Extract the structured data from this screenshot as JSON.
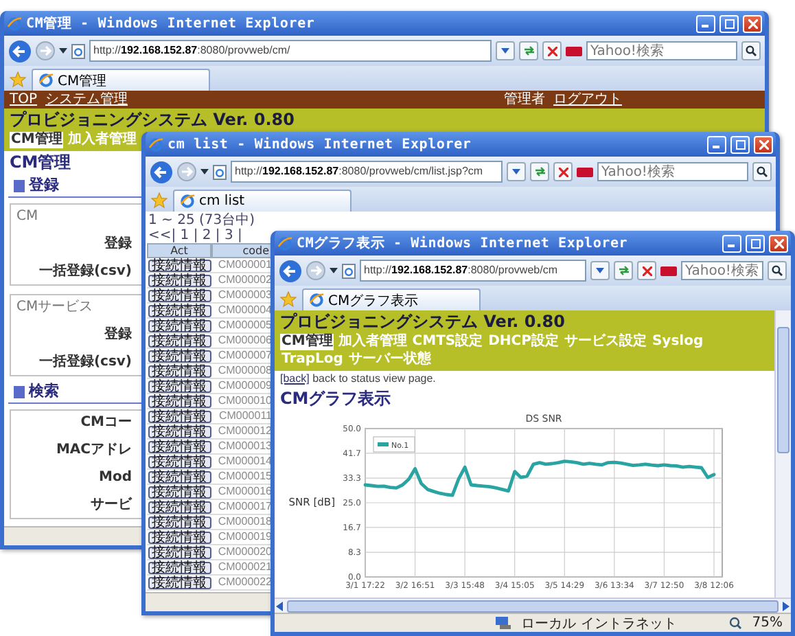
{
  "cm_window": {
    "title": "CM管理 - Windows Internet Explorer",
    "address": "http://**192.168.152.87**:8080/provweb/cm/",
    "search": {
      "placeholder": "Yahoo!検索"
    },
    "tab": "CM管理",
    "top_links": [
      "TOP",
      "システム管理"
    ],
    "user": {
      "label": "管理者",
      "link": "ログアウト"
    },
    "system_title": "プロビジョニングシステム Ver. 0.80",
    "menu": [
      {
        "label": "CM管理",
        "selected": true
      },
      {
        "label": "加入者管理",
        "selected": false
      }
    ],
    "heading": "CM管理",
    "sections": [
      {
        "title": "登録",
        "groups": [
          {
            "legend": "CM",
            "labels": [
              "登録",
              "一括登録(csv)"
            ]
          },
          {
            "legend": "CMサービス",
            "labels": [
              "登録",
              "一括登録(csv)"
            ]
          }
        ]
      },
      {
        "title": "検索",
        "groups": [
          {
            "labels": [
              "CMコー",
              "MACアドレ",
              "Mod",
              "サービ"
            ]
          }
        ]
      }
    ]
  },
  "list_window": {
    "title": "cm list - Windows Internet Explorer",
    "address": "http://**192.168.152.87**:8080/provweb/cm/list.jsp?cm",
    "search": {
      "placeholder": "Yahoo!検索"
    },
    "tab": "cm list",
    "pager": "1 ~ 25 (73台中) <<| 1 | 2 | 3 |",
    "columns": [
      "Act",
      "code"
    ],
    "rows": [
      {
        "action": "接続情報",
        "code": "CM000001"
      },
      {
        "action": "接続情報",
        "code": "CM000002"
      },
      {
        "action": "接続情報",
        "code": "CM000003"
      },
      {
        "action": "接続情報",
        "code": "CM000004"
      },
      {
        "action": "接続情報",
        "code": "CM000005"
      },
      {
        "action": "接続情報",
        "code": "CM000006"
      },
      {
        "action": "接続情報",
        "code": "CM000007"
      },
      {
        "action": "接続情報",
        "code": "CM000008"
      },
      {
        "action": "接続情報",
        "code": "CM000009"
      },
      {
        "action": "接続情報",
        "code": "CM000010"
      },
      {
        "action": "接続情報",
        "code": "CM000011"
      },
      {
        "action": "接続情報",
        "code": "CM000012"
      },
      {
        "action": "接続情報",
        "code": "CM000013"
      },
      {
        "action": "接続情報",
        "code": "CM000014"
      },
      {
        "action": "接続情報",
        "code": "CM000015"
      },
      {
        "action": "接続情報",
        "code": "CM000016"
      },
      {
        "action": "接続情報",
        "code": "CM000017"
      },
      {
        "action": "接続情報",
        "code": "CM000018"
      },
      {
        "action": "接続情報",
        "code": "CM000019"
      },
      {
        "action": "接続情報",
        "code": "CM000020"
      },
      {
        "action": "接続情報",
        "code": "CM000021"
      },
      {
        "action": "接続情報",
        "code": "CM000022"
      }
    ]
  },
  "graph_window": {
    "title": "CMグラフ表示 - Windows Internet Explorer",
    "address": "http://**192.168.152.87**:8080/provweb/cm",
    "search": {
      "placeholder": "Yahoo!検索"
    },
    "tab": "CMグラフ表示",
    "system_title": "プロビジョニングシステム Ver. 0.80",
    "menu": [
      {
        "label": "CM管理",
        "selected": true
      },
      {
        "label": "加入者管理",
        "selected": false
      },
      {
        "label": "CMTS設定",
        "selected": false
      },
      {
        "label": "DHCP設定",
        "selected": false
      },
      {
        "label": "サービス設定",
        "selected": false
      },
      {
        "label": "Syslog",
        "selected": false
      },
      {
        "label": "TrapLog",
        "selected": false
      },
      {
        "label": "サーバー状態",
        "selected": false
      }
    ],
    "back_link": "[back]",
    "back_text": "back to status view page.",
    "heading": "CMグラフ表示",
    "chart_data": {
      "type": "line",
      "title": "DS SNR",
      "ylabel": "SNR [dB]",
      "categories": [
        "3/1 17:22",
        null,
        null,
        null,
        null,
        null,
        null,
        null,
        "3/2 16:51",
        null,
        null,
        null,
        null,
        null,
        null,
        null,
        "3/3 15:48",
        null,
        null,
        null,
        null,
        null,
        null,
        null,
        "3/4 15:05",
        null,
        null,
        null,
        null,
        null,
        null,
        null,
        "3/5 14:29",
        null,
        null,
        null,
        null,
        null,
        null,
        null,
        "3/6 13:34",
        null,
        null,
        null,
        null,
        null,
        null,
        null,
        "3/7 12:50",
        null,
        null,
        null,
        null,
        null,
        null,
        null,
        "3/8 12:06"
      ],
      "series": [
        {
          "name": "No.1",
          "color": "#2aa3a3",
          "values": [
            31.0,
            30.8,
            30.5,
            30.6,
            30.2,
            30.0,
            31.0,
            33.0,
            36.5,
            31.5,
            29.5,
            28.8,
            28.2,
            27.8,
            27.5,
            33.0,
            37.0,
            31.0,
            30.8,
            30.6,
            30.4,
            30.0,
            29.5,
            29.0,
            35.5,
            33.5,
            34.0,
            38.0,
            38.5,
            38.0,
            38.2,
            38.5,
            39.0,
            38.8,
            38.5,
            38.0,
            38.3,
            38.0,
            37.8,
            38.5,
            38.6,
            38.4,
            38.0,
            37.6,
            37.8,
            38.0,
            37.7,
            37.5,
            37.8,
            37.5,
            37.4,
            37.0,
            37.2,
            37.0,
            36.8,
            33.5,
            34.5
          ]
        }
      ],
      "ylim": [
        0,
        50
      ],
      "grid": true,
      "yticks": [
        {
          "value": 0,
          "label": "0.0"
        },
        {
          "value": 8.3,
          "label": "8.3"
        },
        {
          "value": 16.7,
          "label": "16.7"
        },
        {
          "value": 25,
          "label": "25.0"
        },
        {
          "value": 33.3,
          "label": "33.3"
        },
        {
          "value": 41.7,
          "label": "41.7"
        },
        {
          "value": 50,
          "label": "50.0"
        }
      ]
    },
    "status": {
      "zone": "ローカル イントラネット",
      "zoom": "75%"
    }
  }
}
